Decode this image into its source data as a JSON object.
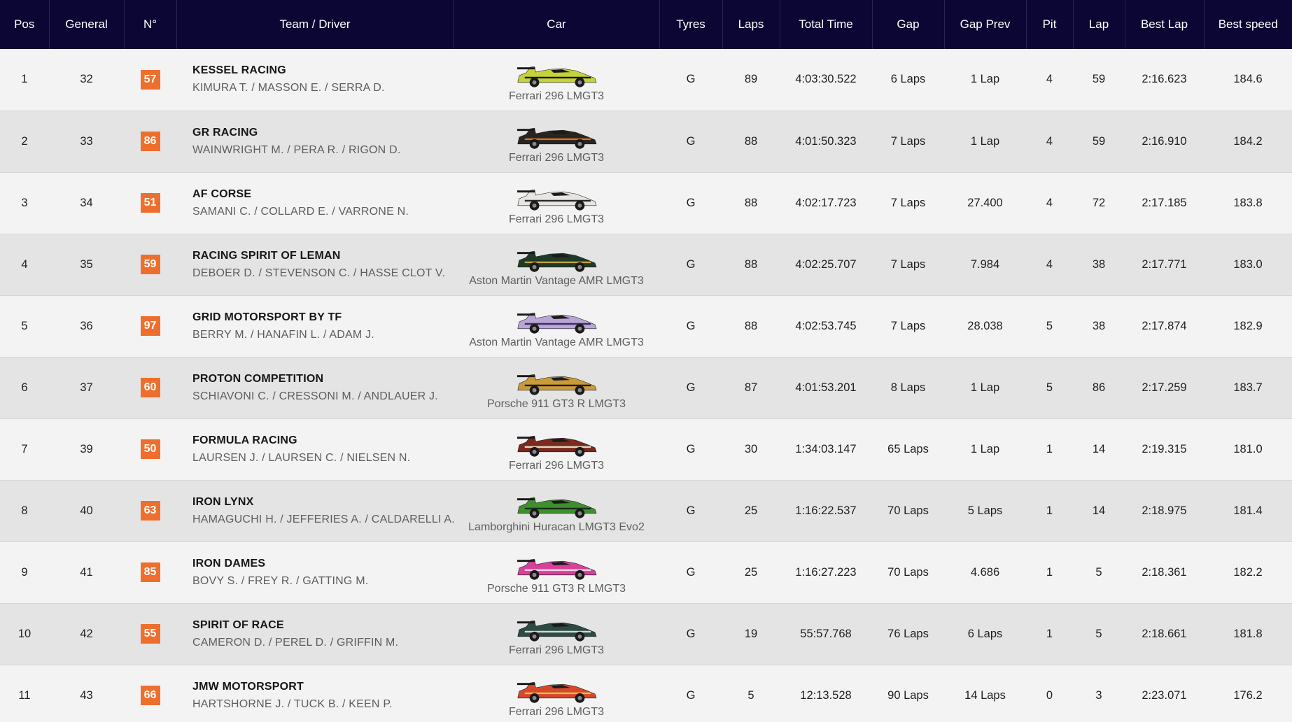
{
  "columns": [
    "Pos",
    "General",
    "N°",
    "Team / Driver",
    "Car",
    "Tyres",
    "Laps",
    "Total Time",
    "Gap",
    "Gap Prev",
    "Pit",
    "Lap",
    "Best Lap",
    "Best speed"
  ],
  "rows": [
    {
      "pos": "1",
      "general": "32",
      "number": "57",
      "team": "KESSEL RACING",
      "drivers": "KIMURA T. / MASSON E. / SERRA D.",
      "car": "Ferrari 296 LMGT3",
      "livery": {
        "body": "#c6d23a",
        "accent": "#1a1a1a"
      },
      "tyres": "G",
      "laps": "89",
      "total_time": "4:03:30.522",
      "gap": "6 Laps",
      "gap_prev": "1 Lap",
      "pit": "4",
      "lap": "59",
      "best_lap": "2:16.623",
      "best_speed": "184.6"
    },
    {
      "pos": "2",
      "general": "33",
      "number": "86",
      "team": "GR RACING",
      "drivers": "WAINWRIGHT M. / PERA R. / RIGON D.",
      "car": "Ferrari 296 LMGT3",
      "livery": {
        "body": "#2a2420",
        "accent": "#c9752e"
      },
      "tyres": "G",
      "laps": "88",
      "total_time": "4:01:50.323",
      "gap": "7 Laps",
      "gap_prev": "1 Lap",
      "pit": "4",
      "lap": "59",
      "best_lap": "2:16.910",
      "best_speed": "184.2"
    },
    {
      "pos": "3",
      "general": "34",
      "number": "51",
      "team": "AF CORSE",
      "drivers": "SAMANI C. / COLLARD E. / VARRONE N.",
      "car": "Ferrari 296 LMGT3",
      "livery": {
        "body": "#e8e6e2",
        "accent": "#2a2a2a"
      },
      "tyres": "G",
      "laps": "88",
      "total_time": "4:02:17.723",
      "gap": "7 Laps",
      "gap_prev": "27.400",
      "pit": "4",
      "lap": "72",
      "best_lap": "2:17.185",
      "best_speed": "183.8"
    },
    {
      "pos": "4",
      "general": "35",
      "number": "59",
      "team": "RACING SPIRIT OF LEMAN",
      "drivers": "DEBOER D. / STEVENSON C. / HASSE CLOT V.",
      "car": "Aston Martin Vantage AMR LMGT3",
      "livery": {
        "body": "#1f3a26",
        "accent": "#c7a23b"
      },
      "tyres": "G",
      "laps": "88",
      "total_time": "4:02:25.707",
      "gap": "7 Laps",
      "gap_prev": "7.984",
      "pit": "4",
      "lap": "38",
      "best_lap": "2:17.771",
      "best_speed": "183.0"
    },
    {
      "pos": "5",
      "general": "36",
      "number": "97",
      "team": "GRID MOTORSPORT BY TF",
      "drivers": "BERRY M. / HANAFIN L. / ADAM J.",
      "car": "Aston Martin Vantage AMR LMGT3",
      "livery": {
        "body": "#b9a6d6",
        "accent": "#3a2f5a"
      },
      "tyres": "G",
      "laps": "88",
      "total_time": "4:02:53.745",
      "gap": "7 Laps",
      "gap_prev": "28.038",
      "pit": "5",
      "lap": "38",
      "best_lap": "2:17.874",
      "best_speed": "182.9"
    },
    {
      "pos": "6",
      "general": "37",
      "number": "60",
      "team": "PROTON COMPETITION",
      "drivers": "SCHIAVONI C. / CRESSONI M. / ANDLAUER J.",
      "car": "Porsche 911 GT3 R LMGT3",
      "livery": {
        "body": "#c99b3a",
        "accent": "#1d1d1d"
      },
      "tyres": "G",
      "laps": "87",
      "total_time": "4:01:53.201",
      "gap": "8 Laps",
      "gap_prev": "1 Lap",
      "pit": "5",
      "lap": "86",
      "best_lap": "2:17.259",
      "best_speed": "183.7"
    },
    {
      "pos": "7",
      "general": "39",
      "number": "50",
      "team": "FORMULA RACING",
      "drivers": "LAURSEN J. / LAURSEN C. / NIELSEN N.",
      "car": "Ferrari 296 LMGT3",
      "livery": {
        "body": "#7a2a1e",
        "accent": "#e3d7c2"
      },
      "tyres": "G",
      "laps": "30",
      "total_time": "1:34:03.147",
      "gap": "65 Laps",
      "gap_prev": "1 Lap",
      "pit": "1",
      "lap": "14",
      "best_lap": "2:19.315",
      "best_speed": "181.0"
    },
    {
      "pos": "8",
      "general": "40",
      "number": "63",
      "team": "IRON LYNX",
      "drivers": "HAMAGUCHI H. / JEFFERIES A. / CALDARELLI A.",
      "car": "Lamborghini Huracan LMGT3 Evo2",
      "livery": {
        "body": "#3f8f2e",
        "accent": "#16301a"
      },
      "tyres": "G",
      "laps": "25",
      "total_time": "1:16:22.537",
      "gap": "70 Laps",
      "gap_prev": "5 Laps",
      "pit": "1",
      "lap": "14",
      "best_lap": "2:18.975",
      "best_speed": "181.4"
    },
    {
      "pos": "9",
      "general": "41",
      "number": "85",
      "team": "IRON DAMES",
      "drivers": "BOVY S. / FREY R. / GATTING M.",
      "car": "Porsche 911 GT3 R LMGT3",
      "livery": {
        "body": "#d7419a",
        "accent": "#f4d6e6"
      },
      "tyres": "G",
      "laps": "25",
      "total_time": "1:16:27.223",
      "gap": "70 Laps",
      "gap_prev": "4.686",
      "pit": "1",
      "lap": "5",
      "best_lap": "2:18.361",
      "best_speed": "182.2"
    },
    {
      "pos": "10",
      "general": "42",
      "number": "55",
      "team": "SPIRIT OF RACE",
      "drivers": "CAMERON D. / PEREL D. / GRIFFIN M.",
      "car": "Ferrari 296 LMGT3",
      "livery": {
        "body": "#2d4a44",
        "accent": "#d8d8d8"
      },
      "tyres": "G",
      "laps": "19",
      "total_time": "55:57.768",
      "gap": "76 Laps",
      "gap_prev": "6 Laps",
      "pit": "1",
      "lap": "5",
      "best_lap": "2:18.661",
      "best_speed": "181.8"
    },
    {
      "pos": "11",
      "general": "43",
      "number": "66",
      "team": "JMW MOTORSPORT",
      "drivers": "HARTSHORNE J. / TUCK B. / KEEN P.",
      "car": "Ferrari 296 LMGT3",
      "livery": {
        "body": "#d7482b",
        "accent": "#e6c04a"
      },
      "tyres": "G",
      "laps": "5",
      "total_time": "12:13.528",
      "gap": "90 Laps",
      "gap_prev": "14 Laps",
      "pit": "0",
      "lap": "3",
      "best_lap": "2:23.071",
      "best_speed": "176.2"
    }
  ],
  "colors": {
    "header_bg": "#0b0633",
    "badge": "#ee6f2d",
    "row_odd": "#f3f3f3",
    "row_even": "#e4e4e4"
  },
  "icons": {
    "car": "race-car-livery-icon"
  }
}
